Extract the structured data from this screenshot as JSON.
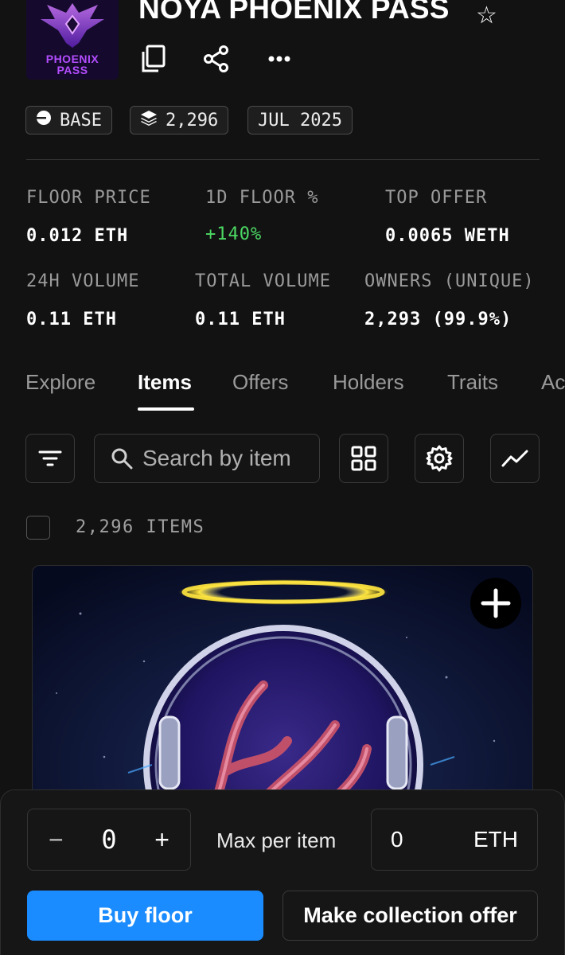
{
  "collection": {
    "logo_text_line1": "PHOENIX",
    "logo_text_line2": "PASS",
    "title": "NOYA PHOENIX PASS",
    "star_icon": "☆"
  },
  "chips": [
    {
      "icon": "base-chain-icon",
      "label": "BASE"
    },
    {
      "icon": "layers-icon",
      "label": "2,296"
    },
    {
      "label": "JUL 2025"
    }
  ],
  "stats": {
    "floor_price_label": "FLOOR PRICE",
    "floor_price_value": "0.012 ETH",
    "floor_change_label": "1D FLOOR %",
    "floor_change_value": "+140%",
    "top_offer_label": "TOP OFFER",
    "top_offer_value": "0.0065 WETH",
    "volume_24h_label": "24H VOLUME",
    "volume_24h_value": "0.11 ETH",
    "total_volume_label": "TOTAL VOLUME",
    "total_volume_value": "0.11 ETH",
    "owners_label": "OWNERS (UNIQUE)",
    "owners_value": "2,293 (99.9%)"
  },
  "tabs": [
    {
      "label": "Explore",
      "active": false
    },
    {
      "label": "Items",
      "active": true
    },
    {
      "label": "Offers",
      "active": false
    },
    {
      "label": "Holders",
      "active": false
    },
    {
      "label": "Traits",
      "active": false
    },
    {
      "label": "Ac",
      "active": false
    }
  ],
  "toolbar": {
    "search_placeholder": "Search by item"
  },
  "items_count": "2,296 ITEMS",
  "bottom_bar": {
    "minus": "−",
    "quantity": "0",
    "plus": "+",
    "max_label": "Max per item",
    "eth_value": "0",
    "eth_unit": "ETH",
    "buy_label": "Buy floor",
    "offer_label": "Make collection offer"
  },
  "colors": {
    "background": "#121212",
    "accent_blue": "#1a8cff",
    "positive_green": "#4cd964",
    "logo_purple": "#b44dff"
  }
}
